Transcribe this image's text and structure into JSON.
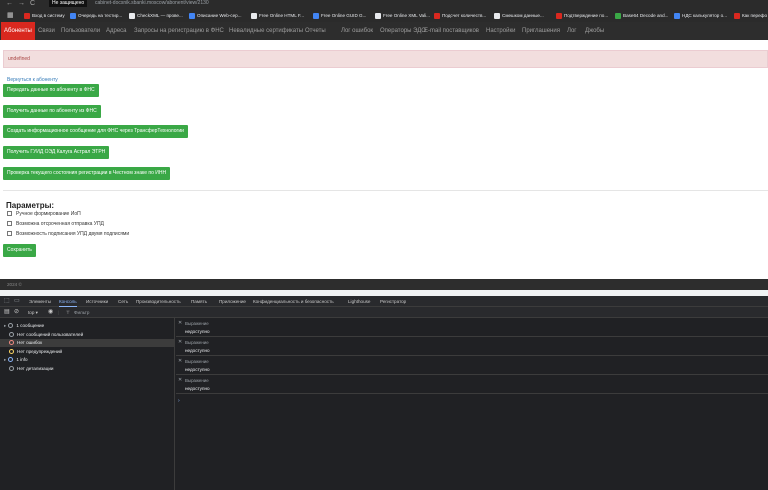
{
  "browser": {
    "nav": {
      "back": "←",
      "forward": "→",
      "reload": "C"
    },
    "secure_badge": "Не защищено",
    "url": "cabinet-docsnik.sbanki.moscow/abonent/view/2130",
    "bookmarks": [
      {
        "label": "Вход в систему",
        "color": "#d9281f"
      },
      {
        "label": "Очередь на тестир...",
        "color": "#4285f4"
      },
      {
        "label": "CheckXML — прове...",
        "color": "#e8eaed"
      },
      {
        "label": "Описание Web-сер...",
        "color": "#4285f4"
      },
      {
        "label": "Free Online HTML F...",
        "color": "#e8eaed"
      },
      {
        "label": "Free Online GUID G...",
        "color": "#4285f4"
      },
      {
        "label": "Free Online XML Vali...",
        "color": "#e8eaed"
      },
      {
        "label": "Подсчет количеств...",
        "color": "#d9281f"
      },
      {
        "label": "Смешком данные...",
        "color": "#e8eaed"
      },
      {
        "label": "Подтверждение по...",
        "color": "#d9281f"
      },
      {
        "label": "Base64 Decode and...",
        "color": "#3aa846"
      },
      {
        "label": "НДС калькулятор о...",
        "color": "#4285f4"
      },
      {
        "label": "Как перефо",
        "color": "#d9281f"
      }
    ]
  },
  "nav": {
    "items": [
      "Абоненты",
      "Связи",
      "Пользователи",
      "Адреса",
      "Запросы на регистрацию в ФНС",
      "Невалидные сертификаты",
      "Отчеты",
      "Лог ошибок",
      "Операторы ЭДО",
      "E-mail поставщиков",
      "Настройки",
      "Приглашения",
      "Лог",
      "Джобы"
    ]
  },
  "alert": {
    "text": "undefined"
  },
  "back_link": "Вернуться к абоненту",
  "actions": [
    "Передать данные по абоненту в ФНС",
    "Получить данные по абоненту из ФНС",
    "Создать информационное сообщение для ФНС через ТрансферТехнологии",
    "Получить ГУИД ОЭД Калуга Астрал ЭТРН",
    "Проверка текущего состояния регистрации в Честном знаке по ИНН"
  ],
  "params": {
    "title": "Параметры:",
    "options": [
      {
        "label": "Ручное формирование ИоП",
        "checked": false
      },
      {
        "label": "Возможна отсроченная отправка УПД",
        "checked": false
      },
      {
        "label": "Возможность подписания УПД двумя подписями",
        "checked": false
      }
    ],
    "save": "Сохранить"
  },
  "footer": "2024 ©",
  "devtools": {
    "tabs": [
      "Элементы",
      "Консоль",
      "Источники",
      "Сеть",
      "Производительность",
      "Память",
      "Приложение",
      "Конфиденциальность и безопасность",
      "Lighthouse",
      "Регистратор"
    ],
    "active_tab": "Консоль",
    "toolbar": {
      "context": "top ▾",
      "filter_placeholder": "Фильтр"
    },
    "sidebar": [
      {
        "label": "1 сообщение",
        "icon": "list-icon",
        "color": "#9aa0a6",
        "expander": "▸"
      },
      {
        "label": "Нет сообщений пользователей",
        "icon": "user-icon",
        "color": "#9aa0a6"
      },
      {
        "label": "Нет ошибок",
        "icon": "error-icon",
        "color": "#f28b82"
      },
      {
        "label": "Нет предупреждений",
        "icon": "warning-icon",
        "color": "#fdd663"
      },
      {
        "label": "1 info",
        "icon": "info-icon",
        "color": "#8ab4f8",
        "expander": "▸"
      },
      {
        "label": "Нет детализации",
        "icon": "gear-icon",
        "color": "#9aa0a6"
      }
    ],
    "expressions": [
      {
        "label": "Выражение",
        "value": "недоступно"
      },
      {
        "label": "Выражение",
        "value": "недоступно"
      },
      {
        "label": "Выражение",
        "value": "недоступно"
      },
      {
        "label": "Выражение",
        "value": "недоступно"
      }
    ],
    "prompt": "›"
  }
}
